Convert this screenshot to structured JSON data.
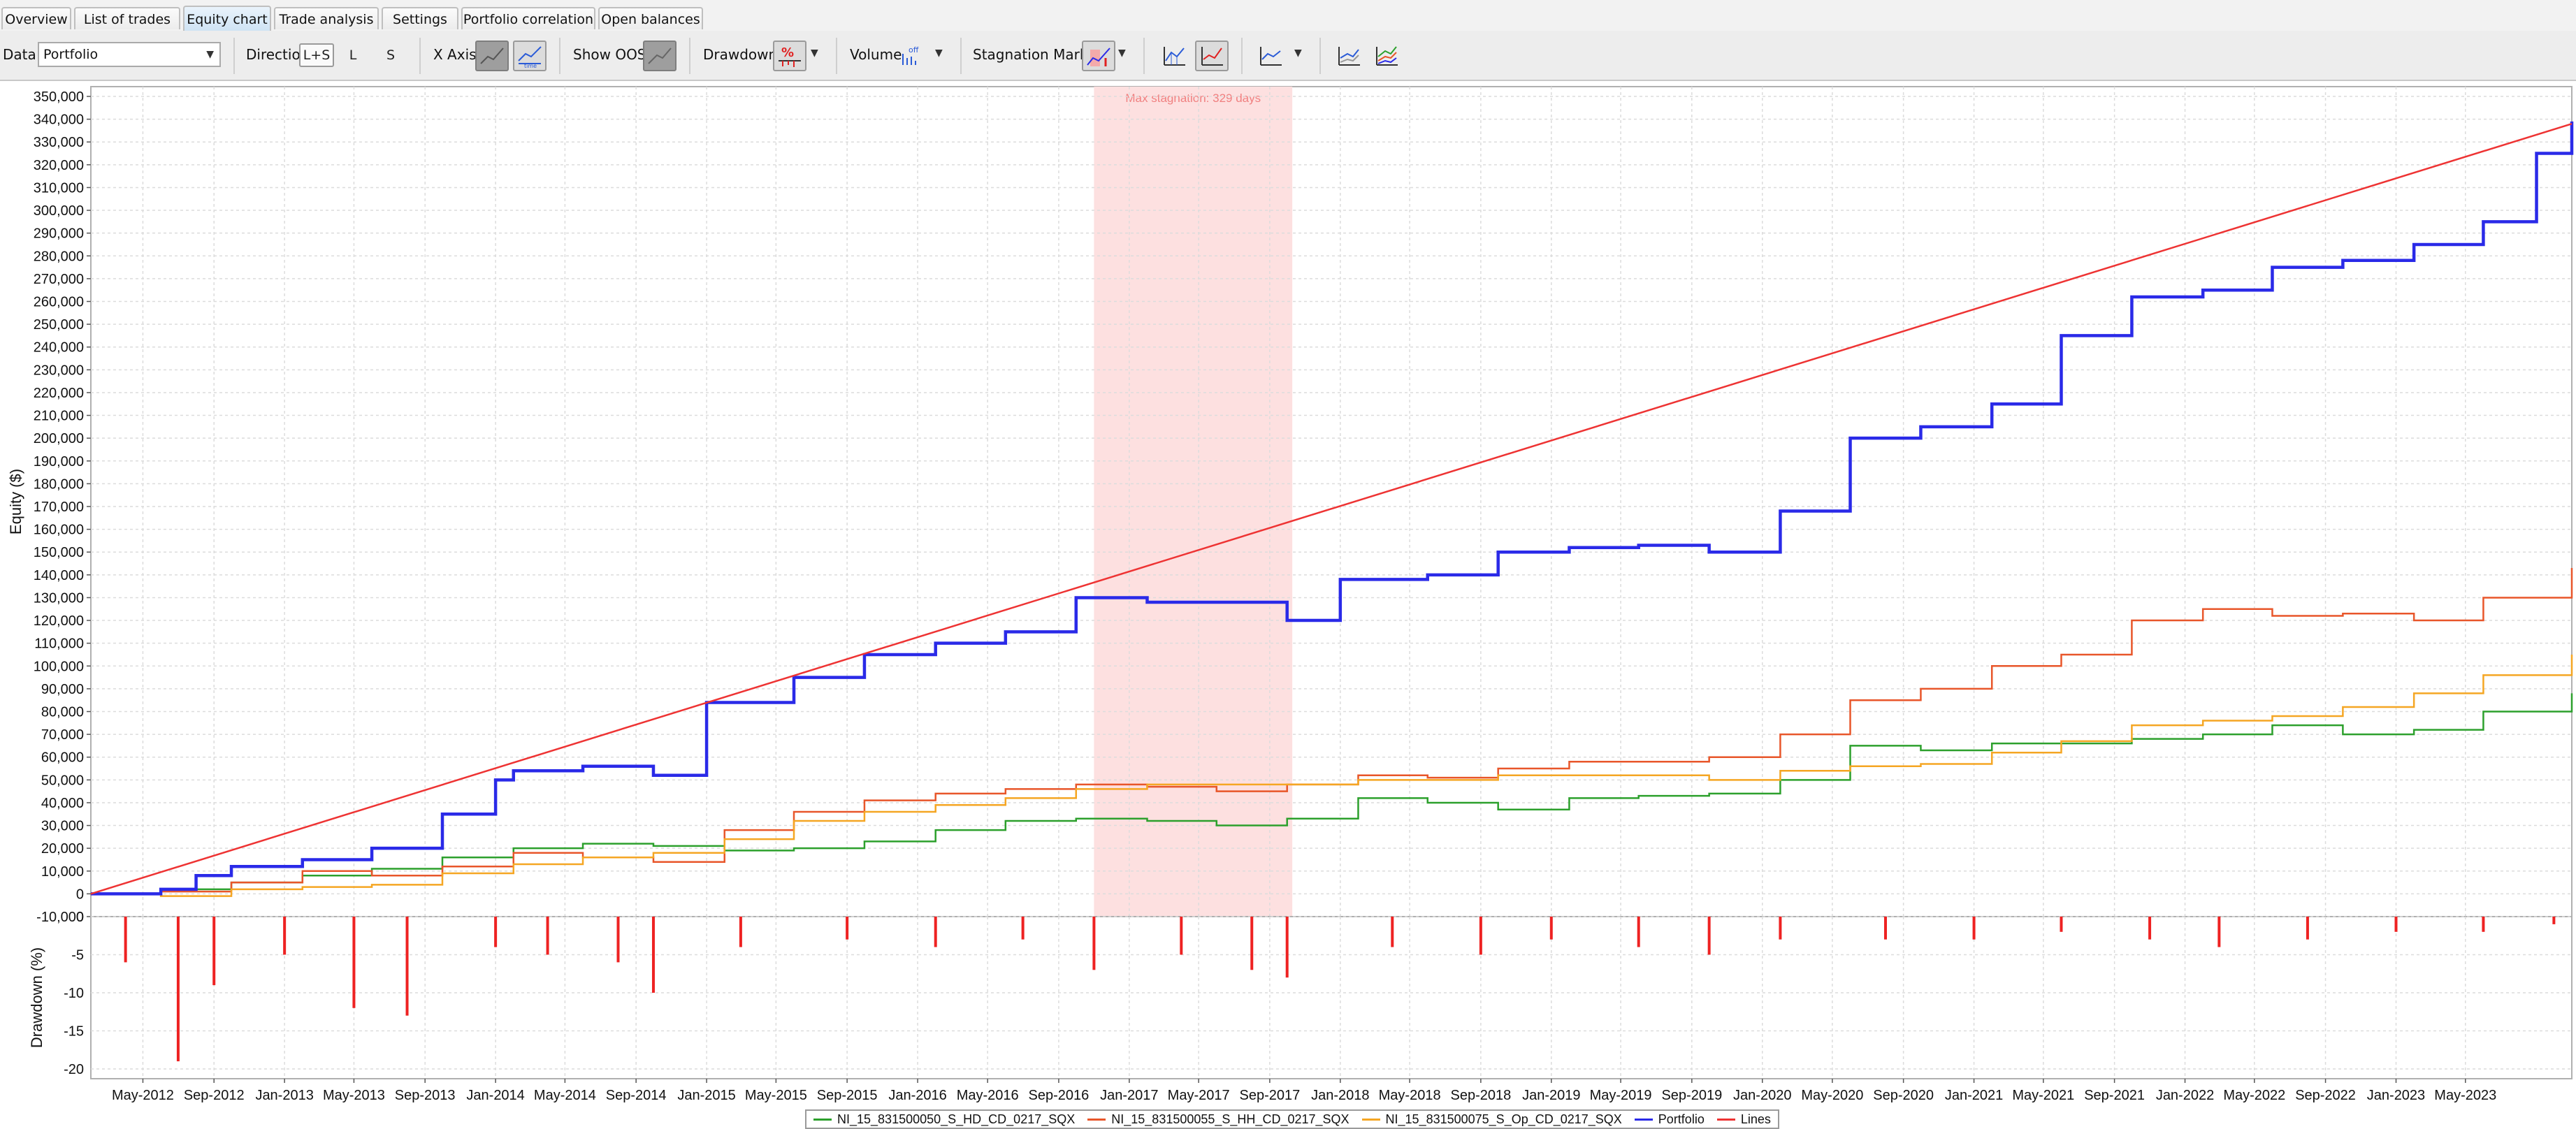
{
  "tabs": [
    {
      "label": "Overview",
      "active": false
    },
    {
      "label": "List of trades",
      "active": false
    },
    {
      "label": "Equity chart",
      "active": true
    },
    {
      "label": "Trade analysis",
      "active": false
    },
    {
      "label": "Settings",
      "active": false
    },
    {
      "label": "Portfolio correlation",
      "active": false
    },
    {
      "label": "Open balances",
      "active": false
    }
  ],
  "toolbar": {
    "data_label": "Data",
    "data_value": "Portfolio",
    "direction_label": "Direction",
    "direction_options": [
      "L+S",
      "L",
      "S"
    ],
    "direction_selected": "L+S",
    "xaxis_label": "X Axis",
    "show_oos_label": "Show OOS",
    "drawdown_label": "Drawdown",
    "volume_label": "Volume",
    "stagnation_label": "Stagnation Marker"
  },
  "chart_data": [
    {
      "type": "line",
      "ylabel": "Equity ($)",
      "ylim": [
        -10000,
        350000
      ],
      "ytick_step": 10000,
      "x_ticks": [
        "May-2012",
        "Sep-2012",
        "Jan-2013",
        "May-2013",
        "Sep-2013",
        "Jan-2014",
        "May-2014",
        "Sep-2014",
        "Jan-2015",
        "May-2015",
        "Sep-2015",
        "Jan-2016",
        "May-2016",
        "Sep-2016",
        "Jan-2017",
        "May-2017",
        "Sep-2017",
        "Jan-2018",
        "May-2018",
        "Sep-2018",
        "Jan-2019",
        "May-2019",
        "Sep-2019",
        "Jan-2020",
        "May-2020",
        "Sep-2020",
        "Jan-2021",
        "May-2021",
        "Sep-2021",
        "Jan-2022",
        "May-2022",
        "Sep-2022",
        "Jan-2023",
        "May-2023"
      ],
      "xlim": [
        "2012-02-01",
        "2023-11-01"
      ],
      "grid": true,
      "annotation": "Max stagnation: 329 days",
      "stagnation_period": [
        "2016-11-01",
        "2017-10-10"
      ],
      "series": [
        {
          "name": "NI_15_831500050_S_HD_CD_0217_SQX",
          "color": "#2ca02c",
          "width": 2.5,
          "x": [
            "2012-02-01",
            "2012-06-01",
            "2012-10-01",
            "2013-02-01",
            "2013-06-01",
            "2013-10-01",
            "2014-02-01",
            "2014-06-01",
            "2014-10-01",
            "2015-02-01",
            "2015-06-01",
            "2015-10-01",
            "2016-02-01",
            "2016-06-01",
            "2016-10-01",
            "2017-02-01",
            "2017-06-01",
            "2017-10-01",
            "2018-02-01",
            "2018-06-01",
            "2018-10-01",
            "2019-02-01",
            "2019-06-01",
            "2019-10-01",
            "2020-02-01",
            "2020-06-01",
            "2020-10-01",
            "2021-02-01",
            "2021-06-01",
            "2021-10-01",
            "2022-02-01",
            "2022-06-01",
            "2022-10-01",
            "2023-02-01",
            "2023-06-01",
            "2023-11-01"
          ],
          "y": [
            0,
            2000,
            5000,
            8000,
            11000,
            16000,
            20000,
            22000,
            21000,
            19000,
            20000,
            23000,
            28000,
            32000,
            33000,
            32000,
            30000,
            33000,
            42000,
            40000,
            37000,
            42000,
            43000,
            44000,
            50000,
            65000,
            63000,
            66000,
            66000,
            68000,
            70000,
            74000,
            70000,
            72000,
            80000,
            88000
          ]
        },
        {
          "name": "NI_15_831500055_S_HH_CD_0217_SQX",
          "color": "#e8562a",
          "width": 2.5,
          "x": [
            "2012-02-01",
            "2012-06-01",
            "2012-10-01",
            "2013-02-01",
            "2013-06-01",
            "2013-10-01",
            "2014-02-01",
            "2014-06-01",
            "2014-10-01",
            "2015-02-01",
            "2015-06-01",
            "2015-10-01",
            "2016-02-01",
            "2016-06-01",
            "2016-10-01",
            "2017-02-01",
            "2017-06-01",
            "2017-10-01",
            "2018-02-01",
            "2018-06-01",
            "2018-10-01",
            "2019-02-01",
            "2019-06-01",
            "2019-10-01",
            "2020-02-01",
            "2020-06-01",
            "2020-10-01",
            "2021-02-01",
            "2021-06-01",
            "2021-10-01",
            "2022-02-01",
            "2022-06-01",
            "2022-10-01",
            "2023-02-01",
            "2023-06-01",
            "2023-11-01"
          ],
          "y": [
            0,
            1000,
            5000,
            10000,
            8000,
            12000,
            18000,
            16000,
            14000,
            28000,
            36000,
            41000,
            44000,
            46000,
            48000,
            47000,
            45000,
            48000,
            52000,
            51000,
            55000,
            58000,
            58000,
            60000,
            70000,
            85000,
            90000,
            100000,
            105000,
            120000,
            125000,
            122000,
            123000,
            120000,
            130000,
            143000
          ]
        },
        {
          "name": "NI_15_831500075_S_Op_CD_0217_SQX",
          "color": "#f5a623",
          "width": 2.5,
          "x": [
            "2012-02-01",
            "2012-06-01",
            "2012-10-01",
            "2013-02-01",
            "2013-06-01",
            "2013-10-01",
            "2014-02-01",
            "2014-06-01",
            "2014-10-01",
            "2015-02-01",
            "2015-06-01",
            "2015-10-01",
            "2016-02-01",
            "2016-06-01",
            "2016-10-01",
            "2017-02-01",
            "2017-06-01",
            "2017-10-01",
            "2018-02-01",
            "2018-06-01",
            "2018-10-01",
            "2019-02-01",
            "2019-06-01",
            "2019-10-01",
            "2020-02-01",
            "2020-06-01",
            "2020-10-01",
            "2021-02-01",
            "2021-06-01",
            "2021-10-01",
            "2022-02-01",
            "2022-06-01",
            "2022-10-01",
            "2023-02-01",
            "2023-06-01",
            "2023-11-01"
          ],
          "y": [
            0,
            -1000,
            2000,
            3000,
            4000,
            9000,
            13000,
            16000,
            18000,
            24000,
            32000,
            36000,
            39000,
            42000,
            46000,
            48000,
            48000,
            48000,
            50000,
            50000,
            52000,
            52000,
            52000,
            50000,
            54000,
            56000,
            57000,
            62000,
            67000,
            74000,
            76000,
            78000,
            82000,
            88000,
            96000,
            105000
          ]
        },
        {
          "name": "Portfolio",
          "color": "#2a2ae8",
          "width": 4.5,
          "x": [
            "2012-02-01",
            "2012-06-01",
            "2012-08-01",
            "2012-10-01",
            "2013-02-01",
            "2013-06-01",
            "2013-10-01",
            "2014-01-01",
            "2014-02-01",
            "2014-06-01",
            "2014-10-01",
            "2015-01-01",
            "2015-06-01",
            "2015-10-01",
            "2016-02-01",
            "2016-06-01",
            "2016-10-01",
            "2017-02-01",
            "2017-06-01",
            "2017-10-01",
            "2018-01-01",
            "2018-06-01",
            "2018-10-01",
            "2019-02-01",
            "2019-06-01",
            "2019-10-01",
            "2020-02-01",
            "2020-06-01",
            "2020-10-01",
            "2021-02-01",
            "2021-06-01",
            "2021-10-01",
            "2022-02-01",
            "2022-06-01",
            "2022-10-01",
            "2023-02-01",
            "2023-06-01",
            "2023-09-01",
            "2023-11-01"
          ],
          "y": [
            0,
            2000,
            8000,
            12000,
            15000,
            20000,
            35000,
            50000,
            54000,
            56000,
            52000,
            84000,
            95000,
            105000,
            110000,
            115000,
            130000,
            128000,
            128000,
            120000,
            138000,
            140000,
            150000,
            152000,
            153000,
            150000,
            168000,
            200000,
            205000,
            215000,
            245000,
            262000,
            265000,
            275000,
            278000,
            285000,
            295000,
            325000,
            339000
          ]
        },
        {
          "name": "Lines",
          "color": "#ee3333",
          "width": 2.5,
          "x": [
            "2012-02-01",
            "2023-11-01"
          ],
          "y": [
            0,
            338000
          ]
        }
      ]
    },
    {
      "type": "bar",
      "ylabel": "Drawdown (%)",
      "ylim": [
        -20,
        0
      ],
      "yticks": [
        0,
        -5,
        -10,
        -15,
        -20
      ],
      "color": "#ee2222",
      "x": [
        "2012-04-01",
        "2012-07-01",
        "2012-09-01",
        "2013-01-01",
        "2013-05-01",
        "2013-08-01",
        "2014-01-01",
        "2014-04-01",
        "2014-08-01",
        "2014-10-01",
        "2015-03-01",
        "2015-09-01",
        "2016-02-01",
        "2016-07-01",
        "2016-11-01",
        "2017-04-01",
        "2017-08-01",
        "2017-10-01",
        "2018-04-01",
        "2018-09-01",
        "2019-01-01",
        "2019-06-01",
        "2019-10-01",
        "2020-02-01",
        "2020-08-01",
        "2021-01-01",
        "2021-06-01",
        "2021-11-01",
        "2022-03-01",
        "2022-08-01",
        "2023-01-01",
        "2023-06-01",
        "2023-10-01"
      ],
      "values": [
        -6,
        -19,
        -9,
        -5,
        -12,
        -13,
        -4,
        -5,
        -6,
        -10,
        -4,
        -3,
        -4,
        -3,
        -7,
        -5,
        -7,
        -8,
        -4,
        -5,
        -3,
        -4,
        -5,
        -3,
        -3,
        -3,
        -2,
        -3,
        -4,
        -3,
        -2,
        -2,
        -1
      ]
    }
  ]
}
